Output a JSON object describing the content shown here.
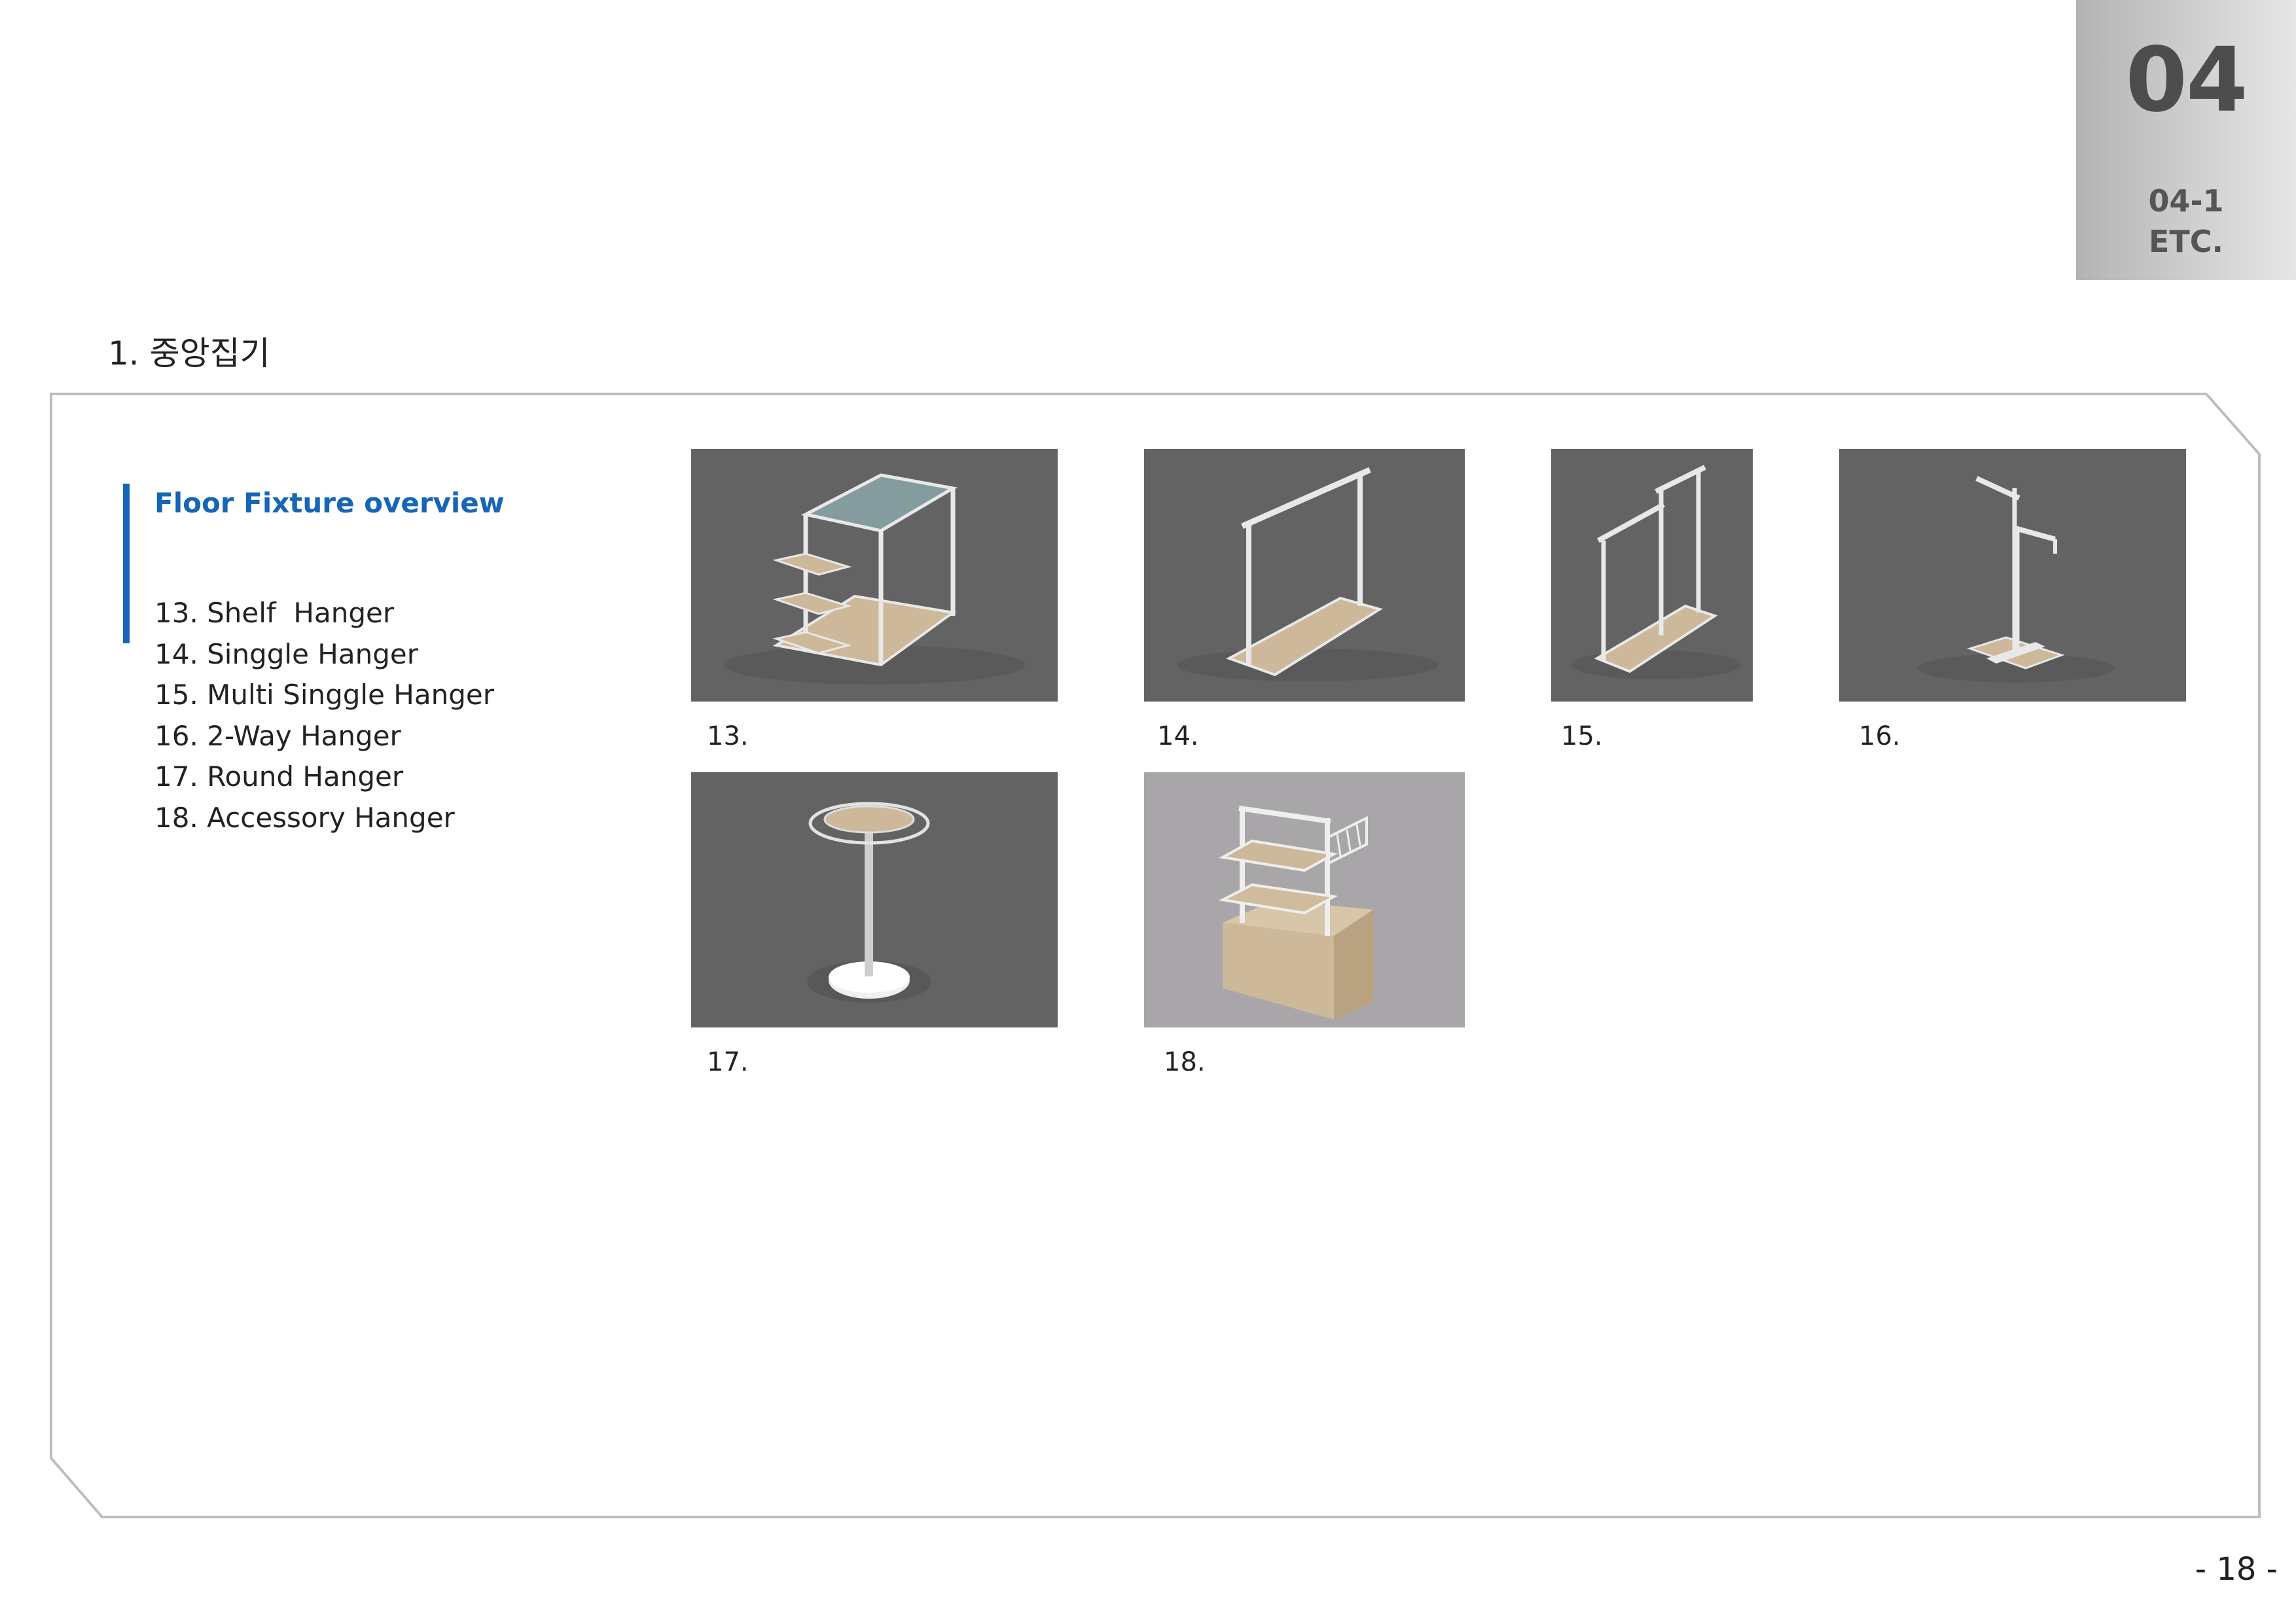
{
  "tab": {
    "number": "04",
    "code": "04-1",
    "label": "ETC."
  },
  "section_title": "1. 중앙집기",
  "overview": {
    "title": "Floor Fixture overview",
    "items": [
      "13. Shelf  Hanger",
      "14. Singgle Hanger",
      "15. Multi Singgle Hanger",
      "16. 2-Way Hanger",
      "17. Round Hanger",
      "18. Accessory Hanger"
    ]
  },
  "gallery": [
    {
      "caption": "13.",
      "icon": "shelf-hanger-render"
    },
    {
      "caption": "14.",
      "icon": "singgle-hanger-render"
    },
    {
      "caption": "15.",
      "icon": "multi-singgle-hanger-render"
    },
    {
      "caption": "16.",
      "icon": "two-way-hanger-render"
    },
    {
      "caption": "17.",
      "icon": "round-hanger-render"
    },
    {
      "caption": "18.",
      "icon": "accessory-hanger-render"
    }
  ],
  "page_number": "- 18 -",
  "colors": {
    "accent": "#1565b8",
    "render_bg": "#636363",
    "wood": "#cdb89a",
    "frame": "#e8e8e8"
  }
}
